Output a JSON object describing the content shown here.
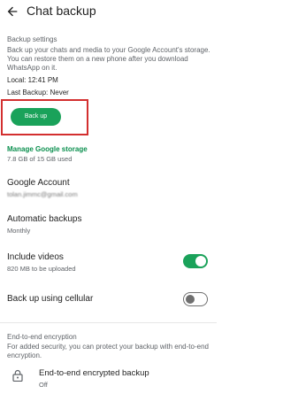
{
  "header": {
    "title": "Chat backup"
  },
  "backup_settings": {
    "section_label": "Backup settings",
    "description": "Back up your chats and media to your Google Account's storage. You can restore them on a new phone after you download WhatsApp on it.",
    "local": "Local: 12:41 PM",
    "last_backup": "Last Backup: Never",
    "back_up_button": "Back up"
  },
  "storage": {
    "link": "Manage Google storage",
    "usage": "7.8 GB of 15 GB used"
  },
  "google_account": {
    "title": "Google Account",
    "email": "tolan.jimmc@gmail.com"
  },
  "automatic_backups": {
    "title": "Automatic backups",
    "value": "Monthly"
  },
  "include_videos": {
    "title": "Include videos",
    "subtitle": "820 MB to be uploaded",
    "enabled": true
  },
  "cellular": {
    "title": "Back up using cellular",
    "enabled": false
  },
  "e2e": {
    "section_label": "End-to-end encryption",
    "description": "For added security, you can protect your backup with end-to-end encryption.",
    "row_title": "End-to-end encrypted backup",
    "row_value": "Off"
  },
  "colors": {
    "accent": "#1aa25a",
    "highlight": "#d32f2f",
    "link": "#0a8f4e"
  }
}
